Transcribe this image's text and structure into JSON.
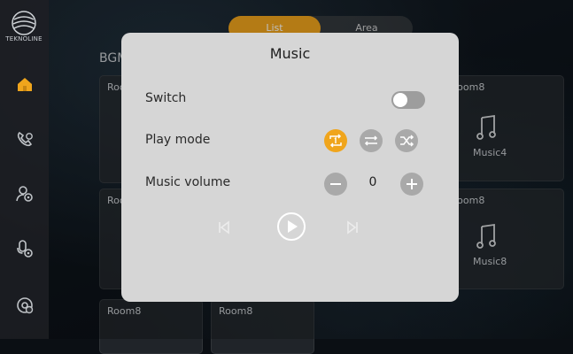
{
  "brand": {
    "name": "TEKNOLINE"
  },
  "sidebar": {
    "items": [
      {
        "icon": "home-icon",
        "active": true
      },
      {
        "icon": "phone-icon",
        "active": false
      },
      {
        "icon": "user-settings-icon",
        "active": false
      },
      {
        "icon": "mic-settings-icon",
        "active": false
      },
      {
        "icon": "settings-icon",
        "active": false
      }
    ]
  },
  "segmented": {
    "tabs": [
      "List",
      "Area"
    ],
    "selected": "List"
  },
  "main": {
    "section_title": "BGM",
    "cards": [
      {
        "title": "Room8",
        "music": ""
      },
      {
        "title": "Room8",
        "music": "Music4"
      },
      {
        "title": "Room8",
        "music": ""
      },
      {
        "title": "Room8",
        "music": "Music8"
      },
      {
        "title": "Room8",
        "music": ""
      },
      {
        "title": "Room8",
        "music": ""
      }
    ]
  },
  "modal": {
    "title": "Music",
    "switch_label": "Switch",
    "switch_on": false,
    "play_mode_label": "Play mode",
    "play_modes": [
      "repeat-one-icon",
      "repeat-all-icon",
      "shuffle-icon"
    ],
    "active_play_mode": "repeat-one-icon",
    "volume_label": "Music volume",
    "volume_value": "0",
    "accent_color": "#f0a51c"
  }
}
